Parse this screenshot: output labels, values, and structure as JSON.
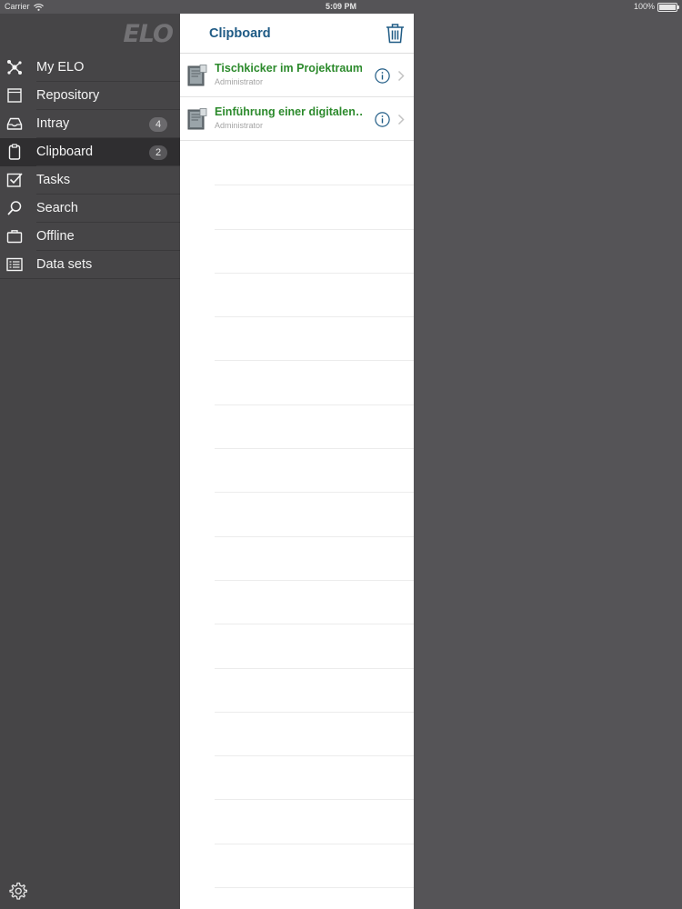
{
  "status_bar": {
    "carrier": "Carrier",
    "time": "5:09 PM",
    "battery": "100%"
  },
  "sidebar": {
    "logo": "ELO",
    "items": [
      {
        "label": "My ELO",
        "icon": "network-icon",
        "badge": ""
      },
      {
        "label": "Repository",
        "icon": "repository-icon",
        "badge": ""
      },
      {
        "label": "Intray",
        "icon": "inbox-tray-icon",
        "badge": "4"
      },
      {
        "label": "Clipboard",
        "icon": "clipboard-icon",
        "badge": "2",
        "active": true
      },
      {
        "label": "Tasks",
        "icon": "checkbox-icon",
        "badge": ""
      },
      {
        "label": "Search",
        "icon": "search-icon",
        "badge": ""
      },
      {
        "label": "Offline",
        "icon": "briefcase-icon",
        "badge": ""
      },
      {
        "label": "Data sets",
        "icon": "list-form-icon",
        "badge": ""
      }
    ],
    "settings_icon": "gear-icon"
  },
  "main": {
    "title": "Clipboard",
    "trash_icon": "trash-icon",
    "items": [
      {
        "title": "Tischkicker im Projektraum",
        "subtitle": "Administrator"
      },
      {
        "title": "Einführung einer digitalen…",
        "subtitle": "Administrator"
      }
    ]
  },
  "colors": {
    "sidebar_bg": "#464547",
    "sidebar_active": "#2f2e30",
    "title_blue": "#1f5b85",
    "item_green": "#2c8a2c",
    "background": "#555457"
  }
}
